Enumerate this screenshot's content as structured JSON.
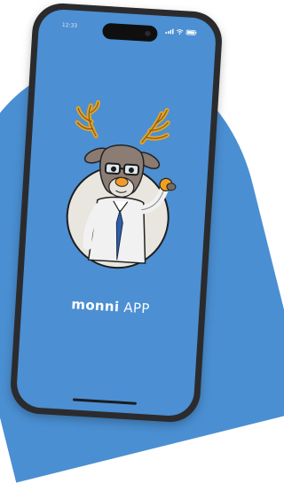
{
  "status_bar": {
    "time": "12:33",
    "icons": [
      "signal-icon",
      "wifi-icon",
      "battery-icon"
    ]
  },
  "app": {
    "brand": "monni",
    "suffix": "APP"
  },
  "mascot": {
    "description_icon": "reindeer-mascot-icon"
  },
  "colors": {
    "screen_bg": "#4c8fd3",
    "page_accent": "#4a8fd2",
    "phone_frame": "#2b2b2e"
  }
}
